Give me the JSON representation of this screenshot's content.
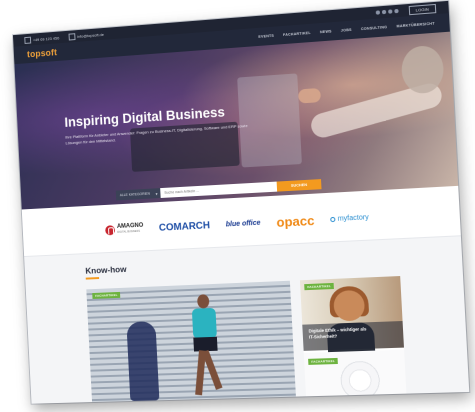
{
  "topbar": {
    "phone": "+49 69 123 456",
    "email": "info@topsoft.de",
    "login": "LOGIN"
  },
  "header": {
    "logo": "topsoft",
    "nav": [
      "EVENTS",
      "FACHARTIKEL",
      "NEWS",
      "JOBS",
      "CONSULTING",
      "MARKTÜBERSICHT"
    ]
  },
  "hero": {
    "title": "Inspiring Digital Business",
    "subtitle": "Ihre Plattform für Anbieter und Anwender: Fragen zu Business-IT, Digitalisierung, Software und ERP sowie Lösungen für den Mittelstand."
  },
  "search": {
    "category": "ALLE KATEGORIEN",
    "placeholder": "Suche nach Artikeln ...",
    "button": "SUCHEN"
  },
  "partners": {
    "amagno_name": "AMAGNO",
    "amagno_tagline": "DIGITAL BUSINESS",
    "comarch": "COMARCH",
    "blueoffice": "blue office",
    "opacc": "opacc",
    "myfactory": "myfactory"
  },
  "knowhow": {
    "title": "Know-how",
    "card1_tag": "FACHARTIKEL",
    "card2_tag": "FACHARTIKEL",
    "card2_heading": "Digitale Ethik – wichtiger als IT-Sicherheit?",
    "card3_tag": "FACHARTIKEL"
  }
}
